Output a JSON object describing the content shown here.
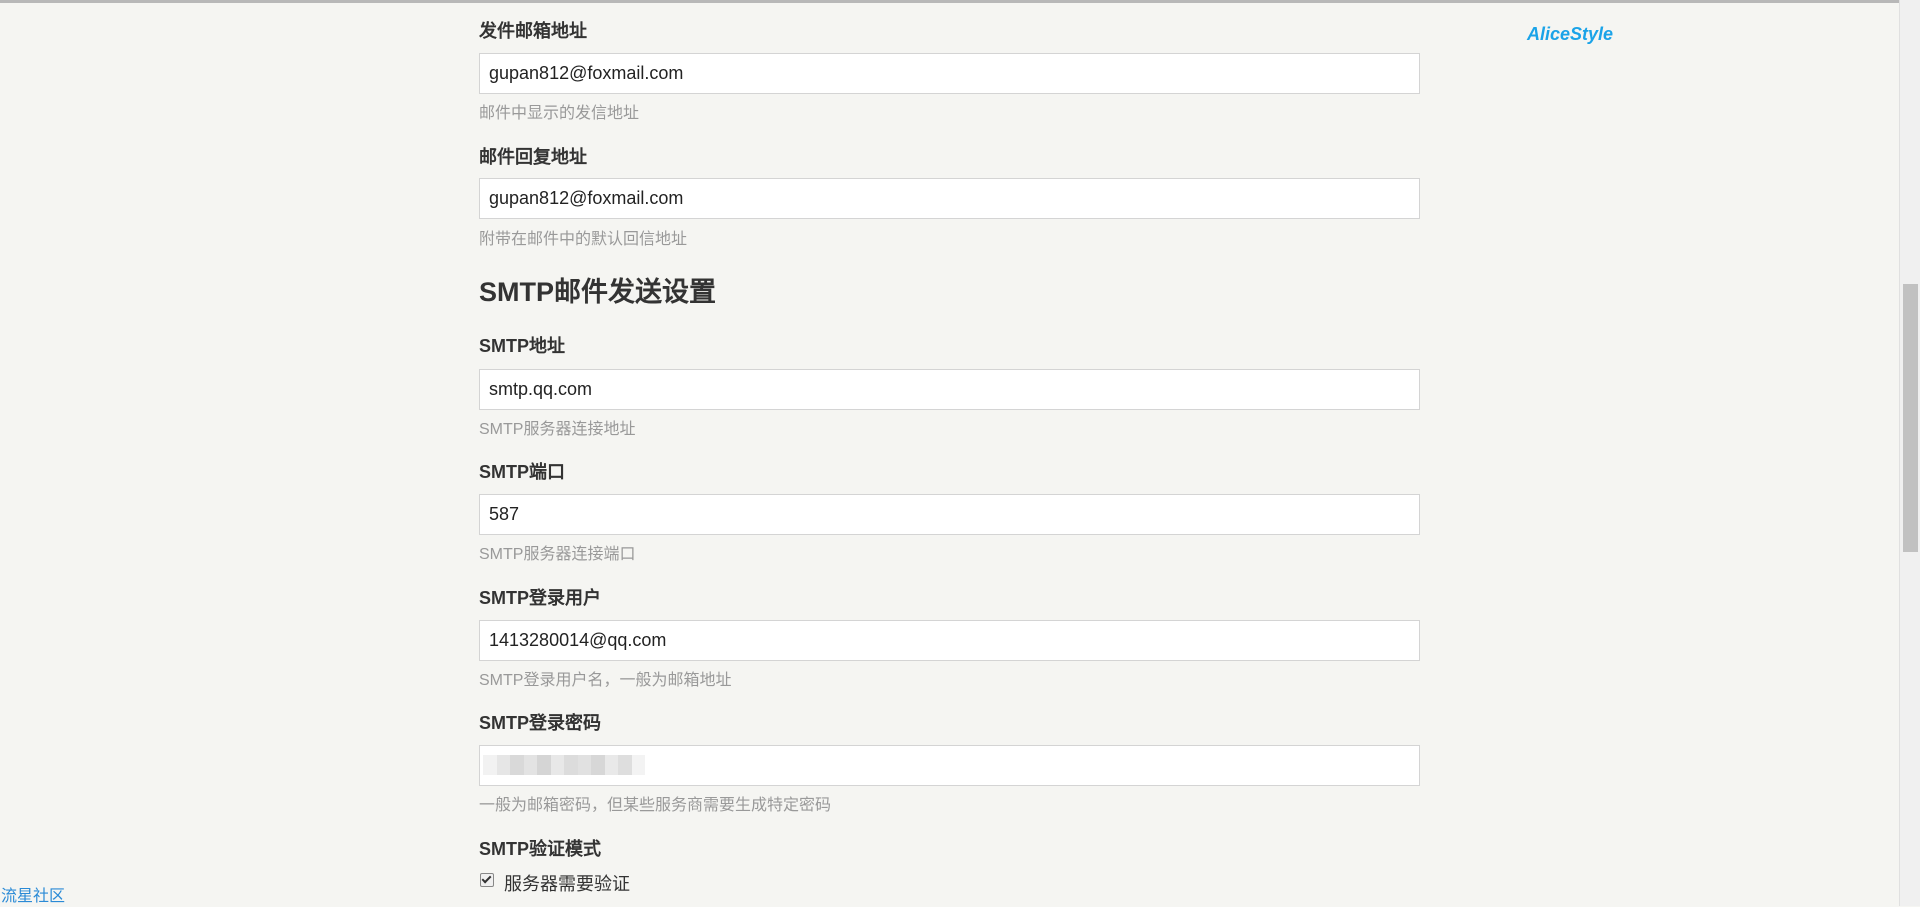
{
  "brand": "AliceStyle",
  "community_link": "流星社区",
  "fields": {
    "sender": {
      "label": "发件邮箱地址",
      "value": "gupan812@foxmail.com",
      "hint": "邮件中显示的发信地址"
    },
    "reply_to": {
      "label": "邮件回复地址",
      "value": "gupan812@foxmail.com",
      "hint": "附带在邮件中的默认回信地址"
    },
    "smtp_host": {
      "label": "SMTP地址",
      "value": "smtp.qq.com",
      "hint": "SMTP服务器连接地址"
    },
    "smtp_port": {
      "label": "SMTP端口",
      "value": "587",
      "hint": "SMTP服务器连接端口"
    },
    "smtp_user": {
      "label": "SMTP登录用户",
      "value": "1413280014@qq.com",
      "hint": "SMTP登录用户名，一般为邮箱地址"
    },
    "smtp_password": {
      "label": "SMTP登录密码",
      "hint": "一般为邮箱密码，但某些服务商需要生成特定密码"
    },
    "smtp_auth": {
      "label": "SMTP验证模式",
      "checkbox_label": "服务器需要验证",
      "checked": true
    }
  },
  "section_title": "SMTP邮件发送设置",
  "colors": {
    "brand": "#1aa3e8",
    "link": "#2a8ad6",
    "background": "#f5f5f2"
  }
}
